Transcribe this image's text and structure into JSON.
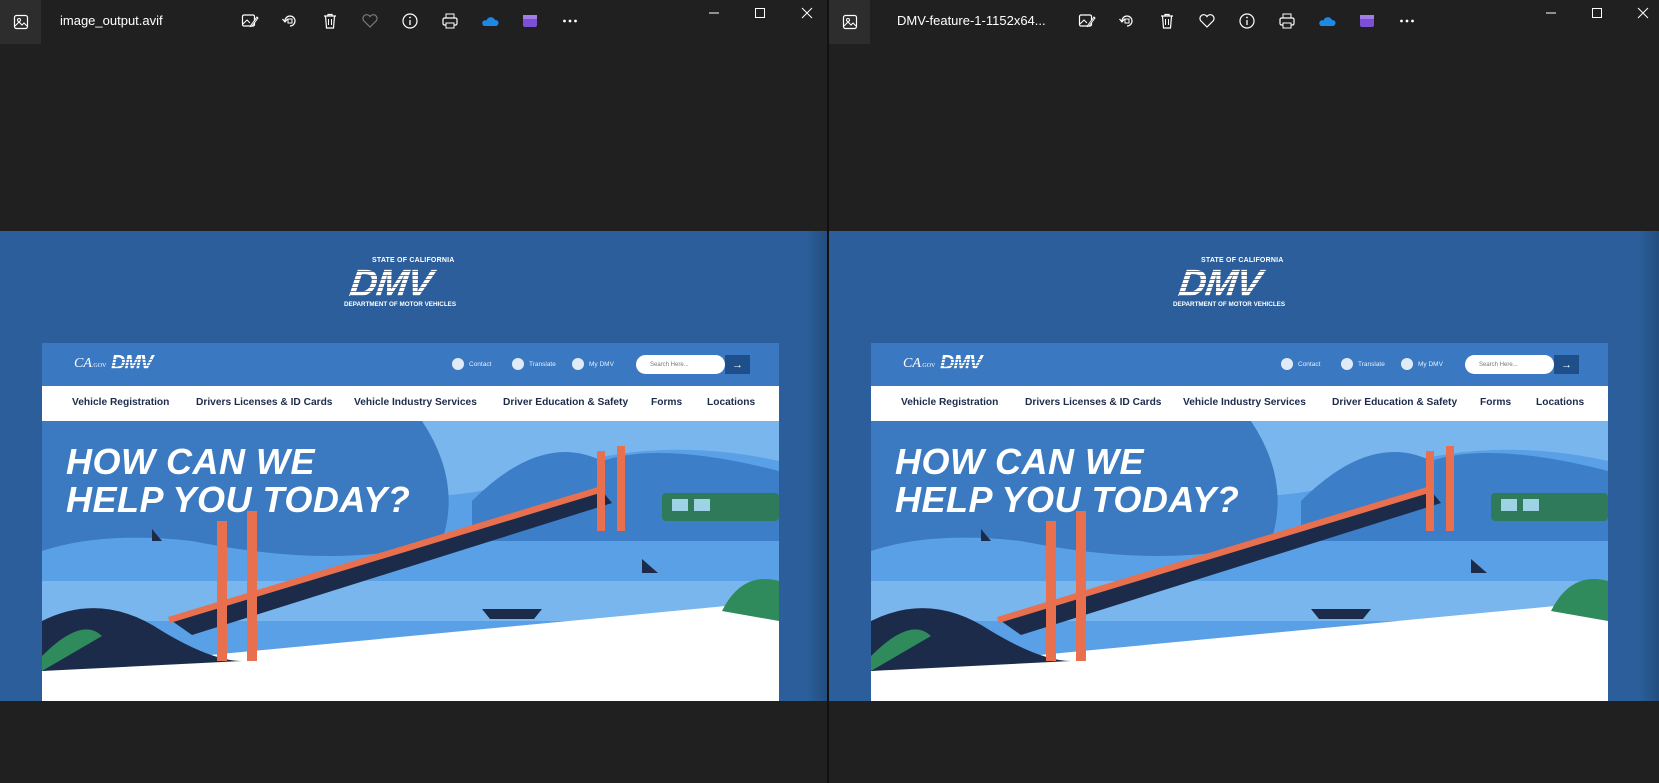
{
  "windows": [
    {
      "title": "image_output.avif",
      "favorite_active": false,
      "website": {
        "logo": {
          "state": "STATE OF CALIFORNIA",
          "name": "DMV",
          "dept": "DEPARTMENT OF MOTOR VEHICLES"
        },
        "top_bar": {
          "ca_logo": "CA",
          "ca_sub": ".GOV",
          "mini_logo": "DMV",
          "contact": "Contact",
          "translate": "Translate",
          "mydmv": "My DMV",
          "search_placeholder": "Search Here..."
        },
        "nav": [
          "Vehicle Registration",
          "Drivers Licenses & ID Cards",
          "Vehicle Industry Services",
          "Driver Education & Safety",
          "Forms",
          "Locations"
        ],
        "hero": {
          "line1": "HOW CAN WE",
          "line2": "HELP YOU TODAY?"
        }
      }
    },
    {
      "title": "DMV-feature-1-1152x64...",
      "favorite_active": true,
      "website": {
        "logo": {
          "state": "STATE OF CALIFORNIA",
          "name": "DMV",
          "dept": "DEPARTMENT OF MOTOR VEHICLES"
        },
        "top_bar": {
          "ca_logo": "CA",
          "ca_sub": ".GOV",
          "mini_logo": "DMV",
          "contact": "Contact",
          "translate": "Translate",
          "mydmv": "My DMV",
          "search_placeholder": "Search Here..."
        },
        "nav": [
          "Vehicle Registration",
          "Drivers Licenses & ID Cards",
          "Vehicle Industry Services",
          "Driver Education & Safety",
          "Forms",
          "Locations"
        ],
        "hero": {
          "line1": "HOW CAN WE",
          "line2": "HELP YOU TODAY?"
        }
      }
    }
  ],
  "toolbar_icons": [
    "edit-image-icon",
    "rotate-icon",
    "delete-icon",
    "favorite-icon",
    "info-icon",
    "print-icon",
    "onedrive-icon",
    "clipchamp-icon",
    "more-icon"
  ],
  "window_controls": [
    "minimize-icon",
    "maximize-icon",
    "close-icon"
  ],
  "colors": {
    "background": "#202020",
    "page_blue": "#2b5e9a",
    "site_top": "#3a78c2",
    "bridge": "#e8704f",
    "onedrive": "#1e88e5",
    "clipchamp": "#7b4fd6"
  }
}
